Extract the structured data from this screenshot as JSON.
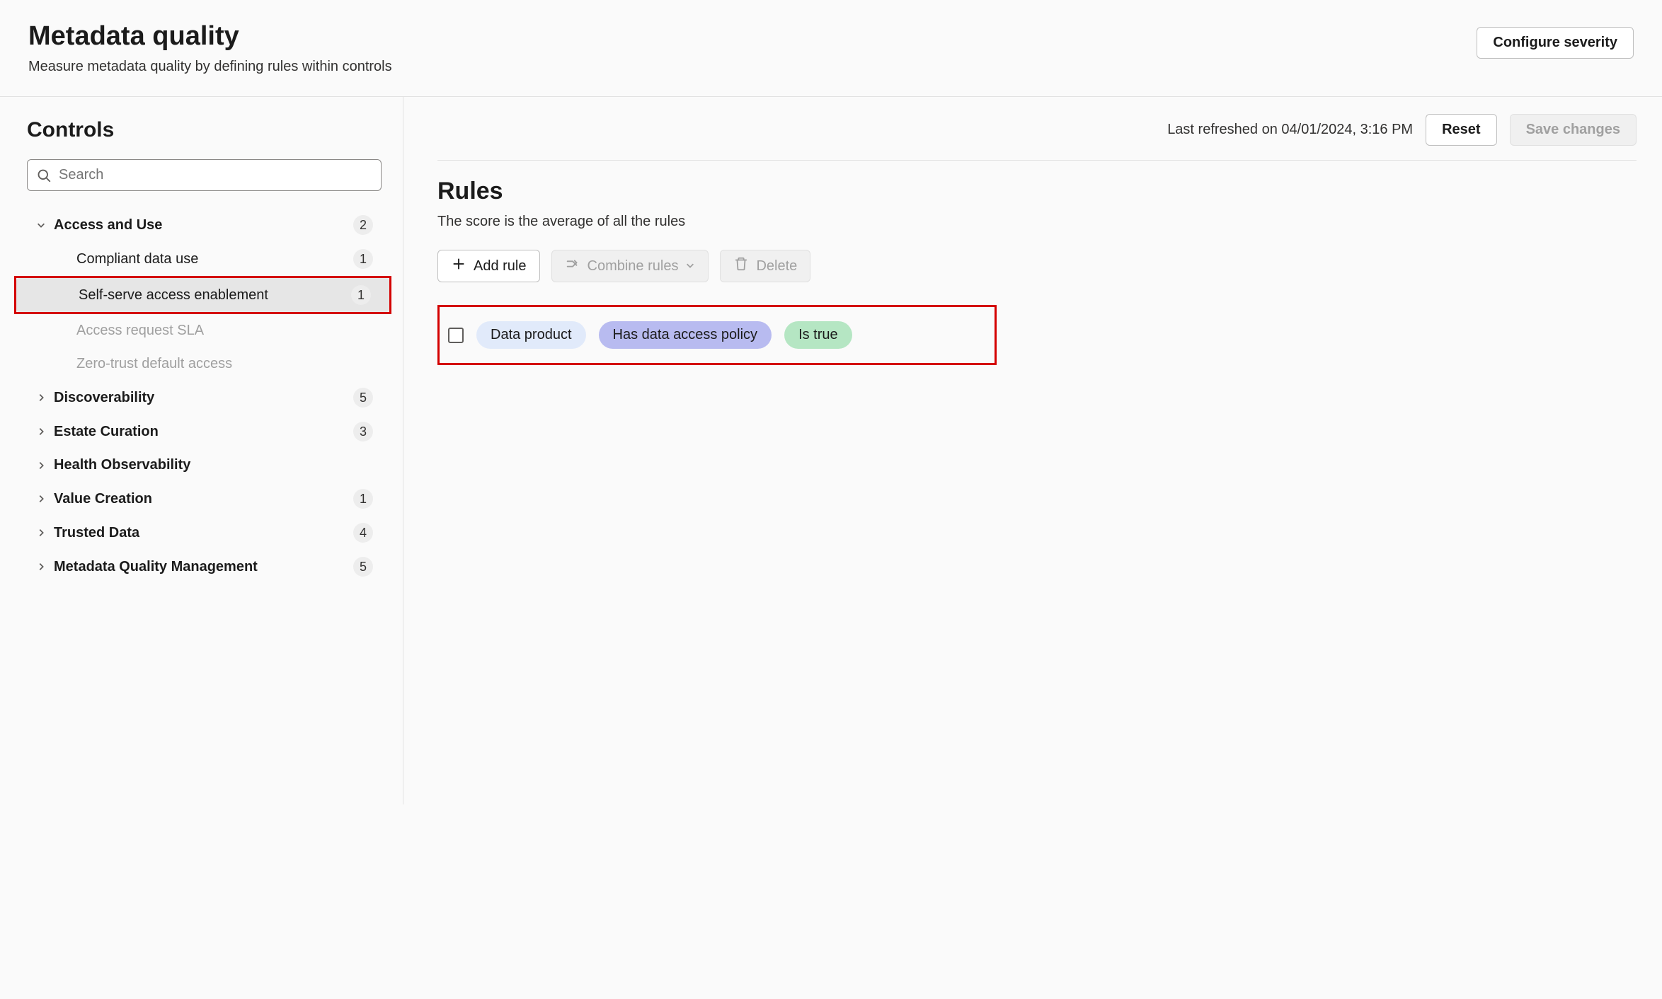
{
  "header": {
    "title": "Metadata quality",
    "subtitle": "Measure metadata quality by defining rules within controls",
    "configure_button": "Configure severity"
  },
  "sidebar": {
    "title": "Controls",
    "search_placeholder": "Search",
    "items": [
      {
        "label": "Access and Use",
        "count": "2",
        "level": 0,
        "expanded": true,
        "selected": false,
        "disabled": false
      },
      {
        "label": "Compliant data use",
        "count": "1",
        "level": 1,
        "expanded": false,
        "selected": false,
        "disabled": false
      },
      {
        "label": "Self-serve access enablement",
        "count": "1",
        "level": 1,
        "expanded": false,
        "selected": true,
        "disabled": false,
        "highlight": true
      },
      {
        "label": "Access request SLA",
        "count": "",
        "level": 1,
        "expanded": false,
        "selected": false,
        "disabled": true
      },
      {
        "label": "Zero-trust default access",
        "count": "",
        "level": 1,
        "expanded": false,
        "selected": false,
        "disabled": true
      },
      {
        "label": "Discoverability",
        "count": "5",
        "level": 0,
        "expanded": false,
        "selected": false,
        "disabled": false
      },
      {
        "label": "Estate Curation",
        "count": "3",
        "level": 0,
        "expanded": false,
        "selected": false,
        "disabled": false
      },
      {
        "label": "Health Observability",
        "count": "",
        "level": 0,
        "expanded": false,
        "selected": false,
        "disabled": false
      },
      {
        "label": "Value Creation",
        "count": "1",
        "level": 0,
        "expanded": false,
        "selected": false,
        "disabled": false
      },
      {
        "label": "Trusted Data",
        "count": "4",
        "level": 0,
        "expanded": false,
        "selected": false,
        "disabled": false
      },
      {
        "label": "Metadata Quality Management",
        "count": "5",
        "level": 0,
        "expanded": false,
        "selected": false,
        "disabled": false
      }
    ]
  },
  "main": {
    "last_refreshed": "Last refreshed on 04/01/2024, 3:16 PM",
    "reset_button": "Reset",
    "save_button": "Save changes",
    "rules_heading": "Rules",
    "rules_desc": "The score is the average of all the rules",
    "toolbar": {
      "add_rule": "Add rule",
      "combine_rules": "Combine rules",
      "delete": "Delete"
    },
    "rules": [
      {
        "pills": [
          {
            "text": "Data product",
            "color": "blue"
          },
          {
            "text": "Has data access policy",
            "color": "purple"
          },
          {
            "text": "Is true",
            "color": "green"
          }
        ],
        "highlight": true
      }
    ]
  }
}
